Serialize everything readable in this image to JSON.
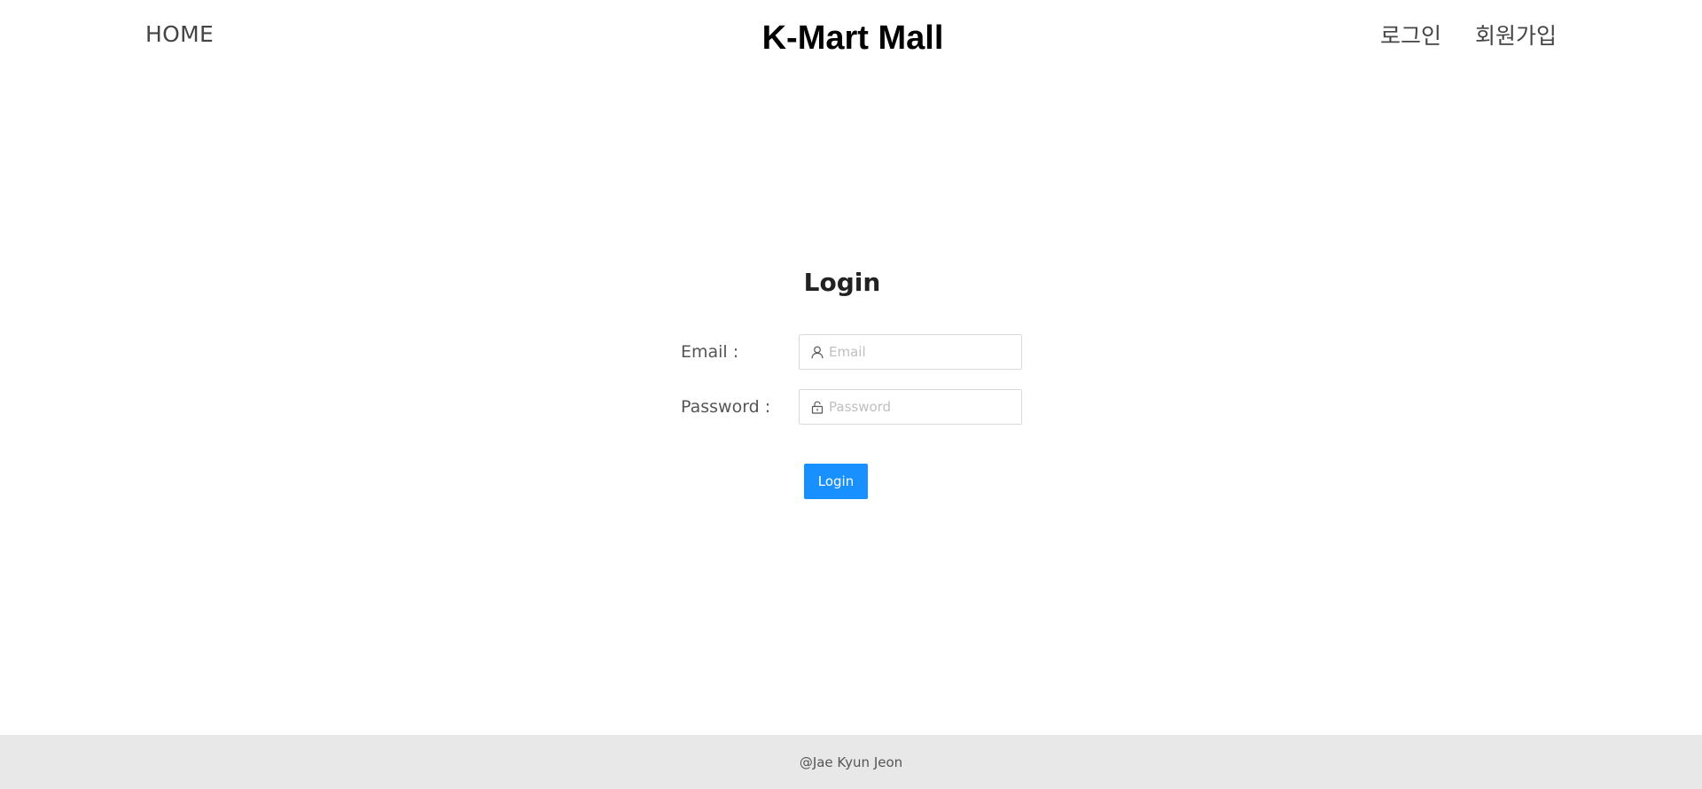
{
  "header": {
    "home_link": "HOME",
    "site_title": "K-Mart Mall",
    "login_link": "로그인",
    "signup_link": "회원가입"
  },
  "login_form": {
    "title": "Login",
    "email_label": "Email :",
    "email_placeholder": "Email",
    "email_value": "",
    "email_icon": "user-icon",
    "password_label": "Password :",
    "password_placeholder": "Password",
    "password_value": "",
    "password_icon": "lock-icon",
    "submit_label": "Login"
  },
  "footer": {
    "credit": "@Jae Kyun Jeon"
  },
  "colors": {
    "primary_button": "#1890ff",
    "footer_background": "#e8e8e8",
    "input_border": "#d9d9d9"
  }
}
